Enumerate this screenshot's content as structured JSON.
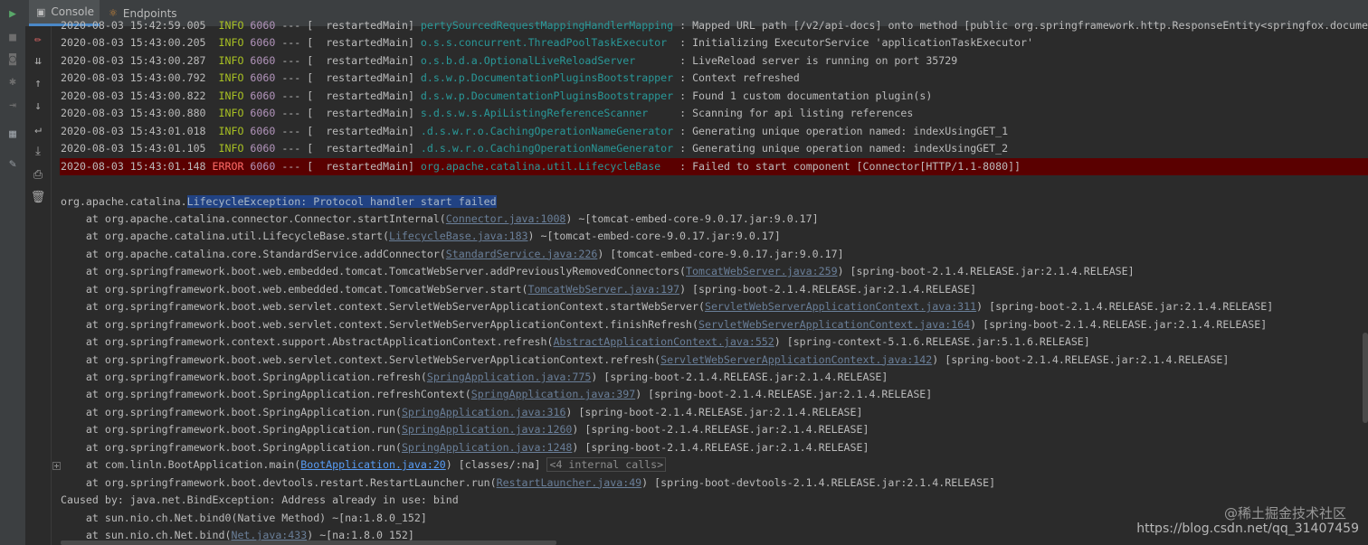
{
  "tabs": [
    {
      "label": "Console",
      "icon": "console-icon",
      "active": true
    },
    {
      "label": "Endpoints",
      "icon": "endpoints-icon",
      "active": false
    }
  ],
  "toolbar": {
    "icons": [
      "run-icon",
      "stop-icon",
      "camera-icon",
      "bug-icon",
      "exit-icon",
      "layout-icon",
      "pin-icon"
    ],
    "side_icons": [
      "clear-icon",
      "scroll-end-icon",
      "up-icon",
      "down-icon",
      "soft-wrap-icon",
      "scroll-to-end-icon",
      "print-icon",
      "trash-icon"
    ]
  },
  "log_lines": [
    {
      "ts": "2020-08-03 15:42:59.005",
      "level": "INFO",
      "pid": "6060",
      "sep": "---",
      "thread": "restartedMain",
      "logger": "pertySourcedRequestMappingHandlerMapping",
      "msg": ": Mapped URL path [/v2/api-docs] onto method [public org.springframework.http.ResponseEntity<springfox.documentati"
    },
    {
      "ts": "2020-08-03 15:43:00.205",
      "level": "INFO",
      "pid": "6060",
      "sep": "---",
      "thread": "restartedMain",
      "logger": "o.s.s.concurrent.ThreadPoolTaskExecutor",
      "msg": ": Initializing ExecutorService 'applicationTaskExecutor'"
    },
    {
      "ts": "2020-08-03 15:43:00.287",
      "level": "INFO",
      "pid": "6060",
      "sep": "---",
      "thread": "restartedMain",
      "logger": "o.s.b.d.a.OptionalLiveReloadServer",
      "msg": ": LiveReload server is running on port 35729"
    },
    {
      "ts": "2020-08-03 15:43:00.792",
      "level": "INFO",
      "pid": "6060",
      "sep": "---",
      "thread": "restartedMain",
      "logger": "d.s.w.p.DocumentationPluginsBootstrapper",
      "msg": ": Context refreshed"
    },
    {
      "ts": "2020-08-03 15:43:00.822",
      "level": "INFO",
      "pid": "6060",
      "sep": "---",
      "thread": "restartedMain",
      "logger": "d.s.w.p.DocumentationPluginsBootstrapper",
      "msg": ": Found 1 custom documentation plugin(s)"
    },
    {
      "ts": "2020-08-03 15:43:00.880",
      "level": "INFO",
      "pid": "6060",
      "sep": "---",
      "thread": "restartedMain",
      "logger": "s.d.s.w.s.ApiListingReferenceScanner",
      "msg": ": Scanning for api listing references"
    },
    {
      "ts": "2020-08-03 15:43:01.018",
      "level": "INFO",
      "pid": "6060",
      "sep": "---",
      "thread": "restartedMain",
      "logger": ".d.s.w.r.o.CachingOperationNameGenerator",
      "msg": ": Generating unique operation named: indexUsingGET_1"
    },
    {
      "ts": "2020-08-03 15:43:01.105",
      "level": "INFO",
      "pid": "6060",
      "sep": "---",
      "thread": "restartedMain",
      "logger": ".d.s.w.r.o.CachingOperationNameGenerator",
      "msg": ": Generating unique operation named: indexUsingGET_2"
    },
    {
      "ts": "2020-08-03 15:43:01.148",
      "level": "ERROR",
      "pid": "6060",
      "sep": "---",
      "thread": "restartedMain",
      "logger": "org.apache.catalina.util.LifecycleBase",
      "msg": ": Failed to start component [Connector[HTTP/1.1-8080]]"
    }
  ],
  "exception": {
    "prefix": "org.apache.catalina.",
    "highlight": "LifecycleException: Protocol handler start failed"
  },
  "stack": [
    {
      "pre": "at org.apache.catalina.connector.Connector.startInternal(",
      "link": "Connector.java:1008",
      "post": ") ~[tomcat-embed-core-9.0.17.jar:9.0.17]"
    },
    {
      "pre": "at org.apache.catalina.util.LifecycleBase.start(",
      "link": "LifecycleBase.java:183",
      "post": ") ~[tomcat-embed-core-9.0.17.jar:9.0.17]"
    },
    {
      "pre": "at org.apache.catalina.core.StandardService.addConnector(",
      "link": "StandardService.java:226",
      "post": ") [tomcat-embed-core-9.0.17.jar:9.0.17]"
    },
    {
      "pre": "at org.springframework.boot.web.embedded.tomcat.TomcatWebServer.addPreviouslyRemovedConnectors(",
      "link": "TomcatWebServer.java:259",
      "post": ") [spring-boot-2.1.4.RELEASE.jar:2.1.4.RELEASE]"
    },
    {
      "pre": "at org.springframework.boot.web.embedded.tomcat.TomcatWebServer.start(",
      "link": "TomcatWebServer.java:197",
      "post": ") [spring-boot-2.1.4.RELEASE.jar:2.1.4.RELEASE]"
    },
    {
      "pre": "at org.springframework.boot.web.servlet.context.ServletWebServerApplicationContext.startWebServer(",
      "link": "ServletWebServerApplicationContext.java:311",
      "post": ") [spring-boot-2.1.4.RELEASE.jar:2.1.4.RELEASE]"
    },
    {
      "pre": "at org.springframework.boot.web.servlet.context.ServletWebServerApplicationContext.finishRefresh(",
      "link": "ServletWebServerApplicationContext.java:164",
      "post": ") [spring-boot-2.1.4.RELEASE.jar:2.1.4.RELEASE]"
    },
    {
      "pre": "at org.springframework.context.support.AbstractApplicationContext.refresh(",
      "link": "AbstractApplicationContext.java:552",
      "post": ") [spring-context-5.1.6.RELEASE.jar:5.1.6.RELEASE]"
    },
    {
      "pre": "at org.springframework.boot.web.servlet.context.ServletWebServerApplicationContext.refresh(",
      "link": "ServletWebServerApplicationContext.java:142",
      "post": ") [spring-boot-2.1.4.RELEASE.jar:2.1.4.RELEASE]"
    },
    {
      "pre": "at org.springframework.boot.SpringApplication.refresh(",
      "link": "SpringApplication.java:775",
      "post": ") [spring-boot-2.1.4.RELEASE.jar:2.1.4.RELEASE]"
    },
    {
      "pre": "at org.springframework.boot.SpringApplication.refreshContext(",
      "link": "SpringApplication.java:397",
      "post": ") [spring-boot-2.1.4.RELEASE.jar:2.1.4.RELEASE]"
    },
    {
      "pre": "at org.springframework.boot.SpringApplication.run(",
      "link": "SpringApplication.java:316",
      "post": ") [spring-boot-2.1.4.RELEASE.jar:2.1.4.RELEASE]"
    },
    {
      "pre": "at org.springframework.boot.SpringApplication.run(",
      "link": "SpringApplication.java:1260",
      "post": ") [spring-boot-2.1.4.RELEASE.jar:2.1.4.RELEASE]"
    },
    {
      "pre": "at org.springframework.boot.SpringApplication.run(",
      "link": "SpringApplication.java:1248",
      "post": ") [spring-boot-2.1.4.RELEASE.jar:2.1.4.RELEASE]"
    },
    {
      "pre": "at com.linln.BootApplication.main(",
      "link": "BootApplication.java:20",
      "post": ") [classes/:na] ",
      "internal": "<4 internal calls>",
      "primary": true
    },
    {
      "pre": "at org.springframework.boot.devtools.restart.RestartLauncher.run(",
      "link": "RestartLauncher.java:49",
      "post": ") [spring-boot-devtools-2.1.4.RELEASE.jar:2.1.4.RELEASE]"
    }
  ],
  "caused_by": "Caused by: java.net.BindException: Address already in use: bind",
  "cause_stack": [
    {
      "pre": "at sun.nio.ch.Net.bind0(Native Method) ~[na:1.8.0_152]",
      "link": "",
      "post": ""
    },
    {
      "pre": "at sun.nio.ch.Net.bind(",
      "link": "Net.java:433",
      "post": ") ~[na:1.8.0_152]"
    }
  ],
  "watermark": {
    "brand": "@稀土掘金技术社区",
    "url": "https://blog.csdn.net/qq_31407459"
  }
}
